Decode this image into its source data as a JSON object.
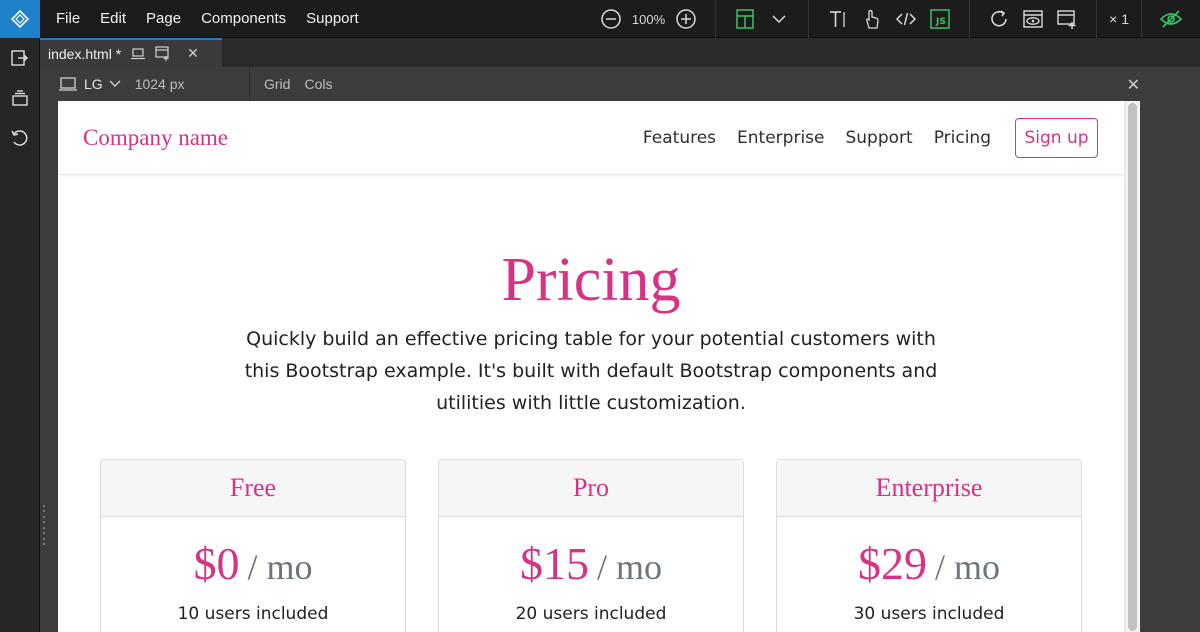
{
  "menubar": {
    "menus": [
      "File",
      "Edit",
      "Page",
      "Components",
      "Support"
    ],
    "zoom": "100%",
    "multiplier": "× 1"
  },
  "tab": {
    "filename": "index.html *"
  },
  "devicebar": {
    "device": "LG",
    "width": "1024 px",
    "grid": "Grid",
    "cols": "Cols"
  },
  "page": {
    "brand": "Company name",
    "nav": [
      "Features",
      "Enterprise",
      "Support",
      "Pricing"
    ],
    "signup": "Sign up",
    "title": "Pricing",
    "description": "Quickly build an effective pricing table for your potential customers with this Bootstrap example. It's built with default Bootstrap components and utilities with little customization.",
    "plans": [
      {
        "name": "Free",
        "price": "$0",
        "unit": "/ mo",
        "users": "10 users included"
      },
      {
        "name": "Pro",
        "price": "$15",
        "unit": "/ mo",
        "users": "20 users included"
      },
      {
        "name": "Enterprise",
        "price": "$29",
        "unit": "/ mo",
        "users": "30 users included"
      }
    ]
  },
  "colors": {
    "accent": "#d63384",
    "app_blue": "#1d82c9",
    "js_green": "#39c26a"
  }
}
